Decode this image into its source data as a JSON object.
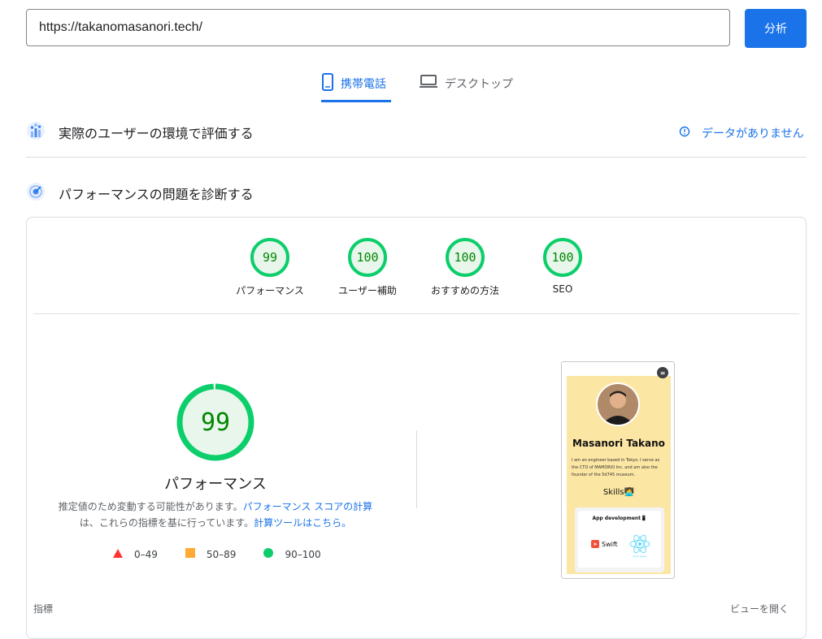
{
  "search": {
    "url": "https://takanomasanori.tech/",
    "analyze_label": "分析"
  },
  "tabs": [
    {
      "label": "携帯電話",
      "active": true,
      "icon": "smartphone-icon"
    },
    {
      "label": "デスクトップ",
      "active": false,
      "icon": "laptop-icon"
    }
  ],
  "field_data": {
    "title": "実際のユーザーの環境で評価する",
    "no_data_label": "データがありません"
  },
  "diagnose": {
    "title": "パフォーマンスの問題を診断する"
  },
  "categories": [
    {
      "label": "パフォーマンス",
      "score": "99"
    },
    {
      "label": "ユーザー補助",
      "score": "100"
    },
    {
      "label": "おすすめの方法",
      "score": "100"
    },
    {
      "label": "SEO",
      "score": "100"
    }
  ],
  "main_score": {
    "value": "99",
    "fraction": 0.99,
    "title": "パフォーマンス"
  },
  "description": {
    "part1": "推定値のため変動する可能性があります。",
    "link1": "パフォーマンス スコアの計算",
    "part2": "は、これらの指標を基に行っています。",
    "link2": "計算ツールはこちら。"
  },
  "legend": [
    {
      "range": "0–49",
      "color": "#ff3333"
    },
    {
      "range": "50–89",
      "color": "#ffaa33"
    },
    {
      "range": "90–100",
      "color": "#0cce6b"
    }
  ],
  "preview": {
    "name": "Masanori Takano",
    "bio": "I am an engineer based in Tokyo. I serve as the CTO of MAMORIO Inc. and am also the founder of the 5d745 museum.",
    "skills": "Skills🧑‍💻",
    "app_dev": "App development📱",
    "swift": "Swift",
    "react": "React Native"
  },
  "footer": {
    "metrics_label": "指標",
    "expand_label": "ビューを開く"
  },
  "colors": {
    "accent": "#1a73e8",
    "pass": "#0cce6b",
    "pass_text": "#008800"
  }
}
